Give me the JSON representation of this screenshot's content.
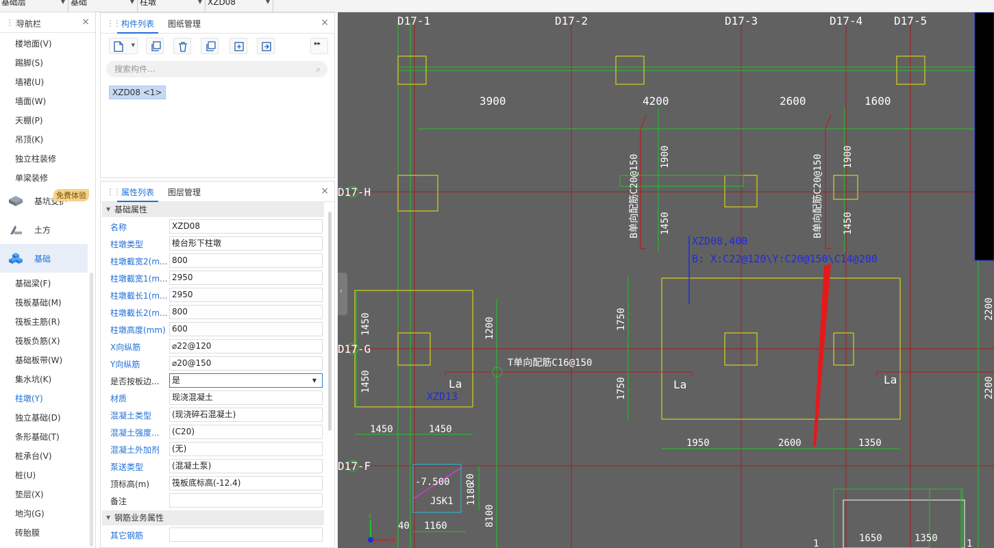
{
  "topbar": {
    "dropdowns": [
      {
        "label": "基础层"
      },
      {
        "label": "基础"
      },
      {
        "label": "柱墩"
      },
      {
        "label": "XZD08"
      }
    ]
  },
  "nav": {
    "title": "导航栏",
    "close_glyph": "×",
    "items_top": [
      "楼地面(V)",
      "踢脚(S)",
      "墙裙(U)",
      "墙面(W)",
      "天棚(P)",
      "吊顶(K)",
      "独立柱装修",
      "单梁装修"
    ],
    "categories": [
      {
        "label": "基坑支护",
        "icon": "pit-support-icon"
      },
      {
        "label": "土方",
        "icon": "earthwork-icon"
      },
      {
        "label": "基础",
        "icon": "foundation-cubes-icon",
        "active": true
      }
    ],
    "badge": "免费体验",
    "items_bottom": [
      "基础梁(F)",
      "筏板基础(M)",
      "筏板主筋(R)",
      "筏板负筋(X)",
      "基础板带(W)",
      "集水坑(K)",
      "柱墩(Y)",
      "独立基础(D)",
      "条形基础(T)",
      "桩承台(V)",
      "桩(U)",
      "垫层(X)",
      "地沟(G)",
      "砖胎膜"
    ],
    "active_item": "柱墩(Y)"
  },
  "components": {
    "tabs": [
      "构件列表",
      "图纸管理"
    ],
    "close_glyph": "×",
    "search_placeholder": "搜索构件...",
    "chip": "XZD08 <1>",
    "toolbar": [
      "new-component-icon",
      "copy-icon",
      "delete-icon",
      "copy-layer-icon",
      "import-icon",
      "export-icon"
    ],
    "more_glyph": "▸▸"
  },
  "properties": {
    "tabs": [
      "属性列表",
      "图层管理"
    ],
    "close_glyph": "×",
    "section_basic": "基础属性",
    "rows": [
      {
        "label": "名称",
        "value": "XZD08",
        "blue": true
      },
      {
        "label": "柱墩类型",
        "value": "棱台形下柱墩",
        "blue": true
      },
      {
        "label": "柱墩截宽2(m...",
        "value": "800",
        "blue": true
      },
      {
        "label": "柱墩截宽1(m...",
        "value": "2950",
        "blue": true
      },
      {
        "label": "柱墩截长1(m...",
        "value": "2950",
        "blue": true
      },
      {
        "label": "柱墩截长2(m...",
        "value": "800",
        "blue": true
      },
      {
        "label": "柱墩高度(mm)",
        "value": "600",
        "blue": true
      },
      {
        "label": "X向纵筋",
        "value": "⌀22@120",
        "blue": true
      },
      {
        "label": "Y向纵筋",
        "value": "⌀20@150",
        "blue": true
      },
      {
        "label": "是否按板边...",
        "value": "是",
        "blue": false,
        "select": true
      },
      {
        "label": "材质",
        "value": "现浇混凝土",
        "blue": true
      },
      {
        "label": "混凝土类型",
        "value": "(现浇碎石混凝土)",
        "blue": true
      },
      {
        "label": "混凝土强度...",
        "value": "(C20)",
        "blue": true
      },
      {
        "label": "混凝土外加剂",
        "value": "(无)",
        "blue": true
      },
      {
        "label": "泵送类型",
        "value": "(混凝土泵)",
        "blue": true
      },
      {
        "label": "顶标高(m)",
        "value": "筏板底标高(-12.4)",
        "blue": false
      },
      {
        "label": "备注",
        "value": "",
        "blue": false
      }
    ],
    "section_rebar": "钢筋业务属性",
    "rows2": [
      {
        "label": "其它钢筋",
        "value": "",
        "blue": true
      }
    ]
  },
  "cad": {
    "axes_top": [
      "D17-1",
      "D17-2",
      "D17-3",
      "D17-4",
      "D17-5"
    ],
    "axes_left": [
      "D17-H",
      "D17-G",
      "D17-F"
    ],
    "spans_top": [
      "3900",
      "4200",
      "2600",
      "1600"
    ],
    "dims": [
      "1900",
      "1450",
      "1450",
      "1450",
      "1200",
      "1750",
      "1750",
      "2200",
      "1450",
      "1450",
      "1950",
      "2600",
      "1350",
      "1650",
      "1350",
      "1160",
      "40",
      "20",
      "1180",
      "8100"
    ],
    "rebar_labels": [
      "B单向配筋C20@150",
      "B单向配筋C20@150",
      "T单向配筋C16@150"
    ],
    "tag_name": "XZD08,400",
    "tag_rebar": "B: X:C22@120\\Y:C20@150\\C14@200",
    "la": [
      "La",
      "La",
      "La",
      "La"
    ],
    "xzd13": "XZD13",
    "elev": "-7.500",
    "jsk": "JSK1",
    "ucs": [
      "Y",
      "X"
    ],
    "one": [
      "1",
      "1"
    ]
  }
}
